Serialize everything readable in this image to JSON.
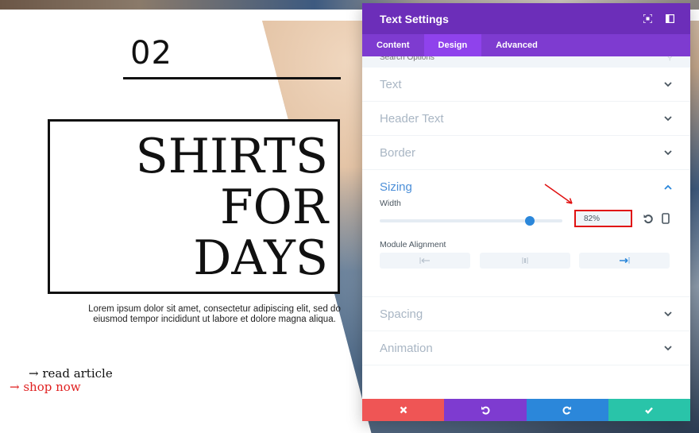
{
  "page": {
    "number": "02",
    "headline": [
      "SHIRTS",
      "FOR",
      "DAYS"
    ],
    "body_text": "Lorem ipsum dolor sit amet, consectetur adipiscing elit, sed do eiusmod tempor incididunt ut labore et dolore magna aliqua.",
    "read_link": "→ read article",
    "shop_link": "→ shop now",
    "shop_link_color": "#e02020"
  },
  "modal": {
    "title": "Text Settings",
    "header_icons": [
      "expand-icon",
      "sidebar-toggle-icon"
    ],
    "header_color": "#6c2eb9",
    "tabs": [
      {
        "label": "Content",
        "active": false
      },
      {
        "label": "Design",
        "active": true
      },
      {
        "label": "Advanced",
        "active": false
      }
    ],
    "search_placeholder": "Search Options",
    "sections": [
      {
        "label": "Text",
        "expanded": false
      },
      {
        "label": "Header Text",
        "expanded": false
      },
      {
        "label": "Border",
        "expanded": false
      },
      {
        "label": "Sizing",
        "expanded": true
      },
      {
        "label": "Spacing",
        "expanded": false
      },
      {
        "label": "Animation",
        "expanded": false
      }
    ],
    "sizing": {
      "width_label": "Width",
      "width_value": "82%",
      "width_slider_percent": 82,
      "alignment_label": "Module Alignment",
      "alignment_options": [
        "left",
        "center",
        "right"
      ],
      "alignment_selected": "right"
    },
    "footer": {
      "cancel": {
        "icon": "close-icon",
        "color": "#ef5555"
      },
      "undo": {
        "icon": "undo-icon",
        "color": "#7e3bd0"
      },
      "redo": {
        "icon": "redo-icon",
        "color": "#2b87da"
      },
      "save": {
        "icon": "check-icon",
        "color": "#29c4a9"
      }
    }
  }
}
